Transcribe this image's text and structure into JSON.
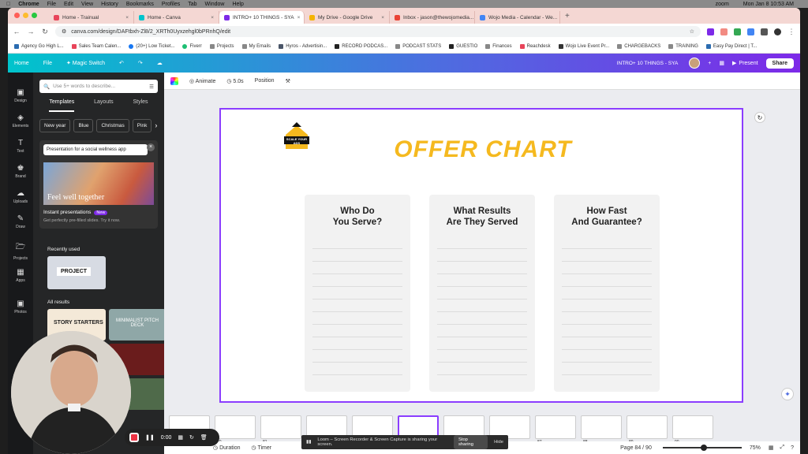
{
  "mac_menu": {
    "app": "Chrome",
    "items": [
      "File",
      "Edit",
      "View",
      "History",
      "Bookmarks",
      "Profiles",
      "Tab",
      "Window",
      "Help"
    ],
    "right_app": "zoom",
    "clock": "Mon Jan 8  10:53 AM"
  },
  "tabs": [
    {
      "label": "Home - Trainual",
      "color": "#e8445a"
    },
    {
      "label": "Home - Canva",
      "color": "#00c4cc"
    },
    {
      "label": "INTRO+ 10 THINGS - SYA",
      "color": "#7d2ae8",
      "active": true
    },
    {
      "label": "My Drive - Google Drive",
      "color": "#f4b400"
    },
    {
      "label": "Inbox - jason@thewojomedia...",
      "color": "#ea4335"
    },
    {
      "label": "Wojo Media - Calendar - We...",
      "color": "#4285f4"
    }
  ],
  "url": "canva.com/design/DAFtbxh-Zl8/2_XRTh0Uyxzehgl0bPRnhQ/edit",
  "bookmarks": [
    "Agency Go High L...",
    "Sales Team Calen...",
    "(20+) Low Ticket...",
    "Fiverr",
    "Projects",
    "My Emails",
    "Hyros - Advertisin...",
    "RECORD PODCAS...",
    "PODCAST STATS",
    "GUESTIO",
    "Finances",
    "Reachdesk",
    "Wojo Live Event Pr...",
    "CHARGEBACKS",
    "TRAINING",
    "Easy Pay Direct | T..."
  ],
  "canva_header": {
    "home": "Home",
    "file": "File",
    "magic_switch": "Magic Switch",
    "doc_title": "INTRO+ 10 THINGS - SYA",
    "present": "Present",
    "share": "Share"
  },
  "rail": [
    {
      "label": "Design",
      "icon": "design-icon"
    },
    {
      "label": "Elements",
      "icon": "elements-icon"
    },
    {
      "label": "Text",
      "icon": "text-icon"
    },
    {
      "label": "Brand",
      "icon": "brand-icon"
    },
    {
      "label": "Uploads",
      "icon": "uploads-icon"
    },
    {
      "label": "Draw",
      "icon": "draw-icon"
    },
    {
      "label": "Projects",
      "icon": "projects-icon"
    },
    {
      "label": "Apps",
      "icon": "apps-icon"
    },
    {
      "label": "Photos",
      "icon": "photos-icon"
    }
  ],
  "panel": {
    "search_placeholder": "Use 5+ words to describe...",
    "tabs": [
      "Templates",
      "Layouts",
      "Styles"
    ],
    "chips": [
      "New year",
      "Blue",
      "Christmas",
      "Pink"
    ],
    "promo_input": "Presentation for a social wellness app",
    "promo_overlay": "Feel well together",
    "promo_title": "Instant presentations",
    "promo_badge": "New",
    "promo_sub": "Get perfectly pre-filled slides. Try it now.",
    "recently_used": "Recently used",
    "recent_thumb": "PROJECT",
    "all_results": "All results",
    "result1": "STORY STARTERS",
    "result2": "MINIMALIST PITCH DECK"
  },
  "toolbar": {
    "animate": "Animate",
    "duration": "5.0s",
    "position": "Position"
  },
  "slide": {
    "logo_text": "SCALE YOUR ADS",
    "title": "OFFER CHART",
    "columns": [
      {
        "line1": "Who Do",
        "line2": "You Serve?"
      },
      {
        "line1": "What Results",
        "line2": "Are They Served"
      },
      {
        "line1": "How Fast",
        "line2": "And Guarantee?"
      }
    ]
  },
  "filmstrip": [
    "79",
    "80",
    "81",
    "82",
    "83",
    "84",
    "85",
    "86",
    "87",
    "88",
    "89",
    "90"
  ],
  "bottombar": {
    "duration": "Duration",
    "timer": "Timer",
    "page": "Page 84 / 90",
    "zoom": "75%"
  },
  "loom": {
    "message": "Loom – Screen Recorder & Screen Capture is sharing your screen.",
    "stop": "Stop sharing",
    "hide": "Hide"
  },
  "recording": {
    "time": "0:00"
  }
}
